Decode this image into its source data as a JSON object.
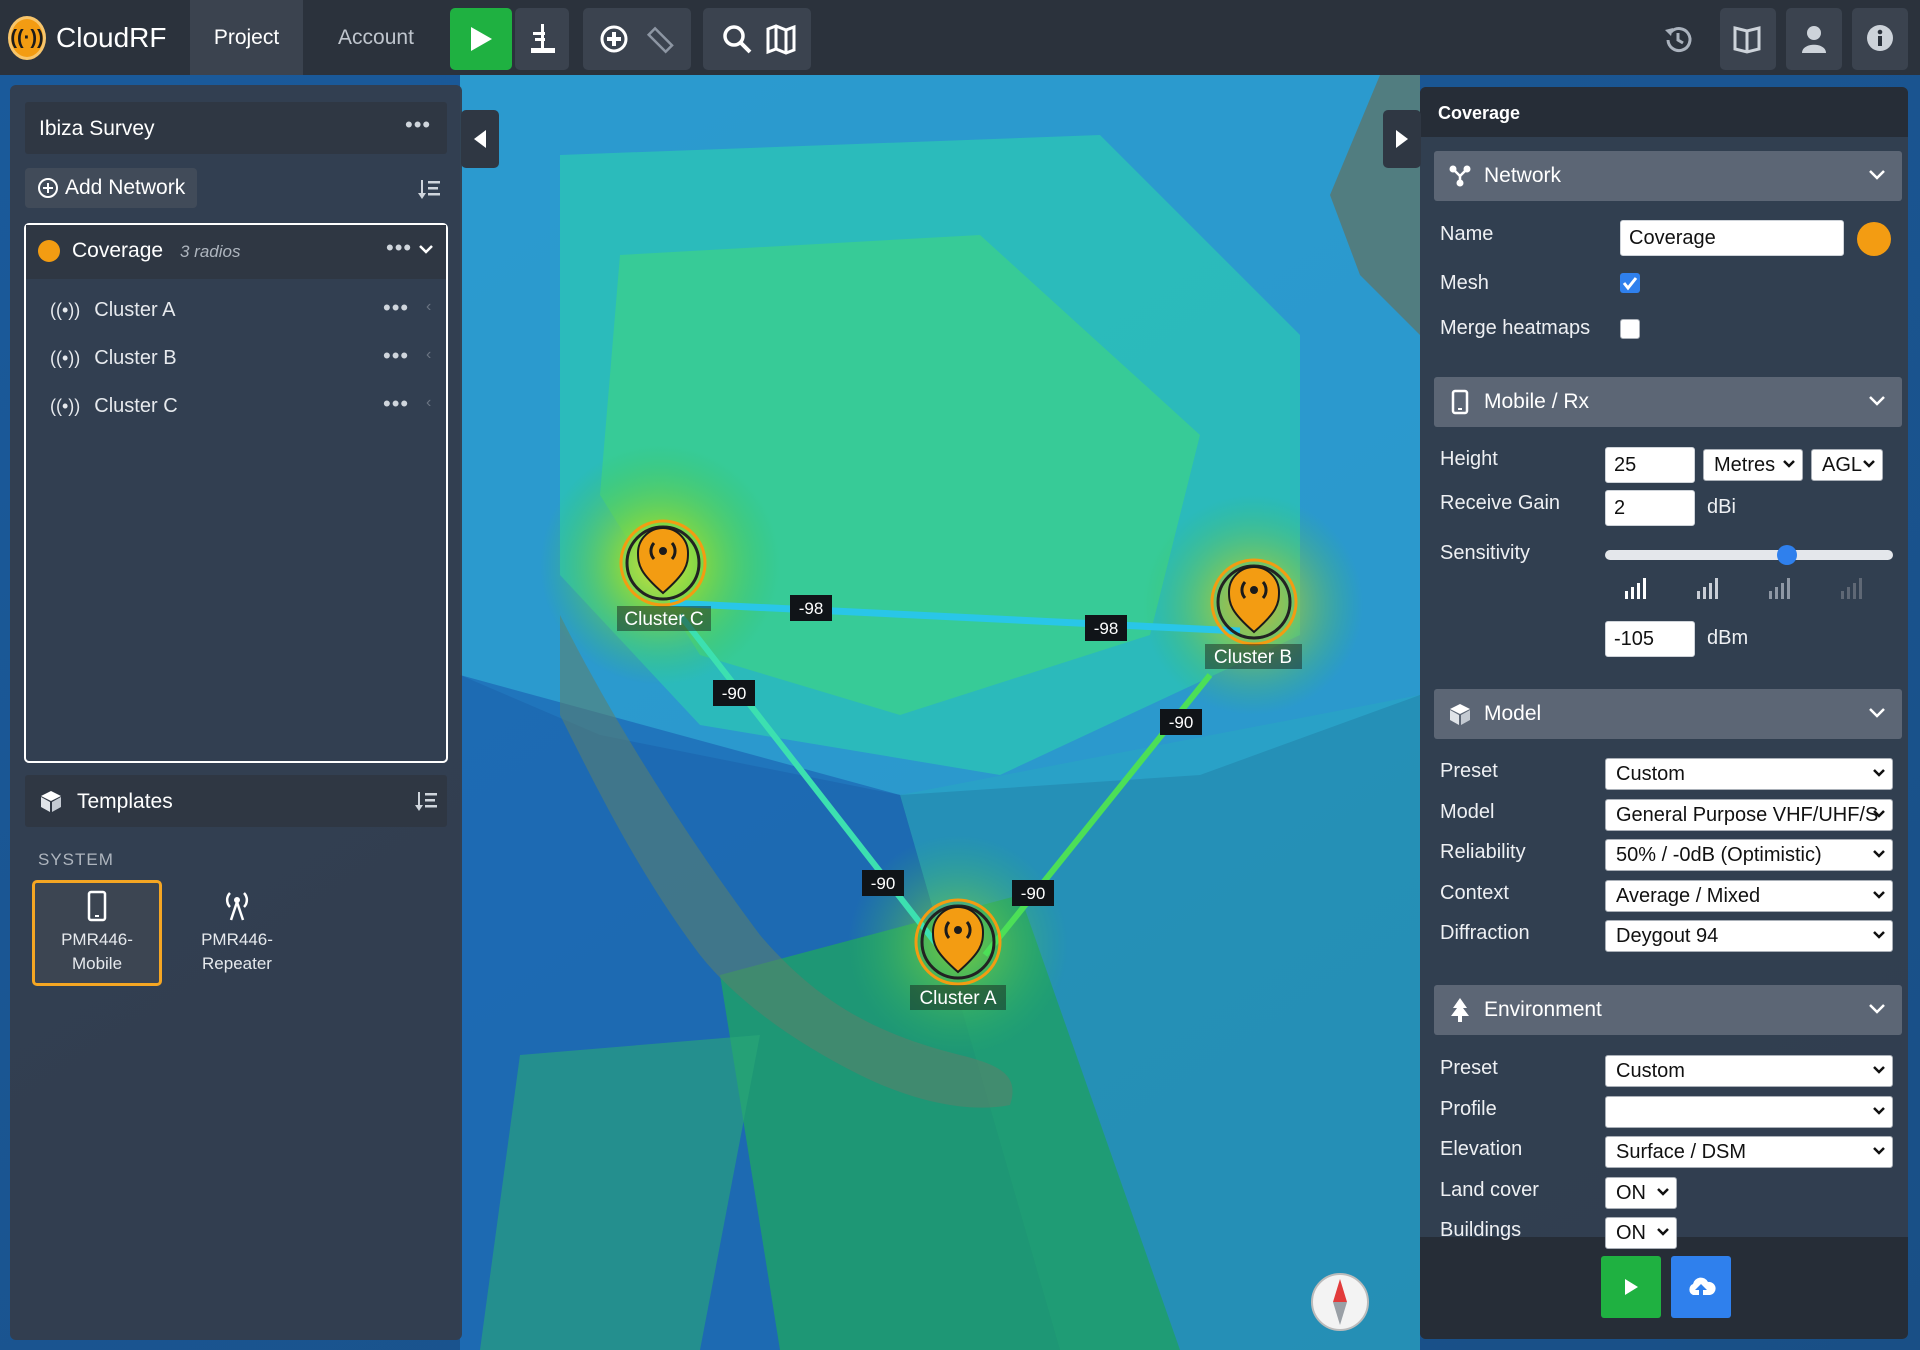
{
  "app": {
    "name": "CloudRF"
  },
  "nav": {
    "project": "Project",
    "account": "Account"
  },
  "left": {
    "project_title": "Ibiza Survey",
    "add_network": "Add Network",
    "network": {
      "name": "Coverage",
      "count": "3 radios",
      "color": "#f39c12"
    },
    "radios": [
      {
        "label": "Cluster A"
      },
      {
        "label": "Cluster B"
      },
      {
        "label": "Cluster C"
      }
    ],
    "templates": "Templates",
    "system_label": "SYSTEM",
    "template_cards": [
      {
        "line1": "PMR446-",
        "line2": "Mobile"
      },
      {
        "line1": "PMR446-",
        "line2": "Repeater"
      }
    ]
  },
  "map": {
    "markers": [
      {
        "label": "Cluster C"
      },
      {
        "label": "Cluster B"
      },
      {
        "label": "Cluster A"
      }
    ],
    "links": [
      {
        "label": "-98"
      },
      {
        "label": "-98"
      },
      {
        "label": "-90"
      },
      {
        "label": "-90"
      },
      {
        "label": "-90"
      },
      {
        "label": "-90"
      }
    ]
  },
  "right": {
    "title": "Coverage",
    "network": {
      "header": "Network",
      "name_label": "Name",
      "name_value": "Coverage",
      "mesh_label": "Mesh",
      "mesh_checked": true,
      "merge_label": "Merge heatmaps",
      "merge_checked": false
    },
    "mobile": {
      "header": "Mobile / Rx",
      "height_label": "Height",
      "height_value": "25",
      "height_unit": "Metres",
      "height_ref": "AGL",
      "gain_label": "Receive Gain",
      "gain_value": "2",
      "gain_unit": "dBi",
      "sens_label": "Sensitivity",
      "sens_value": "-105",
      "sens_unit": "dBm"
    },
    "model": {
      "header": "Model",
      "rows": [
        {
          "label": "Preset",
          "value": "Custom"
        },
        {
          "label": "Model",
          "value": "General Purpose VHF/UHF/S"
        },
        {
          "label": "Reliability",
          "value": "50% / -0dB (Optimistic)"
        },
        {
          "label": "Context",
          "value": "Average / Mixed"
        },
        {
          "label": "Diffraction",
          "value": "Deygout 94"
        }
      ]
    },
    "environment": {
      "header": "Environment",
      "rows": [
        {
          "label": "Preset",
          "value": "Custom"
        },
        {
          "label": "Profile",
          "value": ""
        },
        {
          "label": "Elevation",
          "value": "Surface / DSM"
        },
        {
          "label": "Land cover",
          "value": "ON"
        },
        {
          "label": "Buildings",
          "value": "ON"
        }
      ]
    }
  },
  "colors": {
    "accent": "#f39c12",
    "play": "#1fb141",
    "upload": "#2f80ed",
    "panel": "#343d4b"
  }
}
